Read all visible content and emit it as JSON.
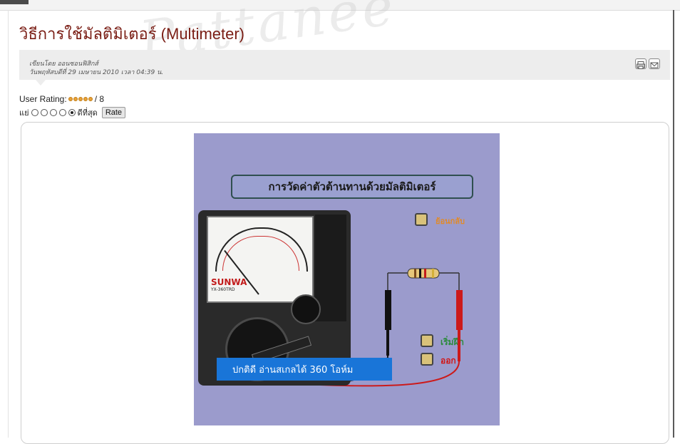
{
  "watermark": "Pattanee",
  "article": {
    "title": "วิธีการใช้มัลติมิเตอร์ (Multimeter)",
    "author_line": "เขียนโดย ออนซอนฟิสิกส์",
    "date_line": "วันพฤหัสบดีที่ 29 เมษายน 2010 เวลา 04:39 น."
  },
  "toolbar": {
    "print_icon": "printer-icon",
    "email_icon": "email-icon"
  },
  "rating": {
    "label": "User Rating:",
    "stars": 5,
    "suffix": "/ 8",
    "worst_label": "แย่",
    "best_label": "ดีที่สุด",
    "options": 5,
    "selected": 5,
    "button": "Rate"
  },
  "flash": {
    "title": "การวัดค่าตัวต้านทานด้วยมัลติมิเตอร์",
    "btn_back": "ย้อนกลับ",
    "btn_start": "เริ่มฝึก",
    "btn_exit": "ออก",
    "readout": "ปกติดี อ่านสเกลได้ 360 โอห์ม",
    "meter_brand": "SUNWA",
    "meter_model": "YX-360TRD",
    "colors": {
      "background": "#9b9bcc",
      "readout_bg": "#1975d8",
      "back_label": "#e08a2a",
      "start_label": "#2a8a3a",
      "exit_label": "#d01818",
      "probe_red": "#cc1a1a",
      "probe_black": "#111111"
    }
  },
  "colors": {
    "title": "#7a1d14",
    "meta_bar": "#ededed"
  }
}
